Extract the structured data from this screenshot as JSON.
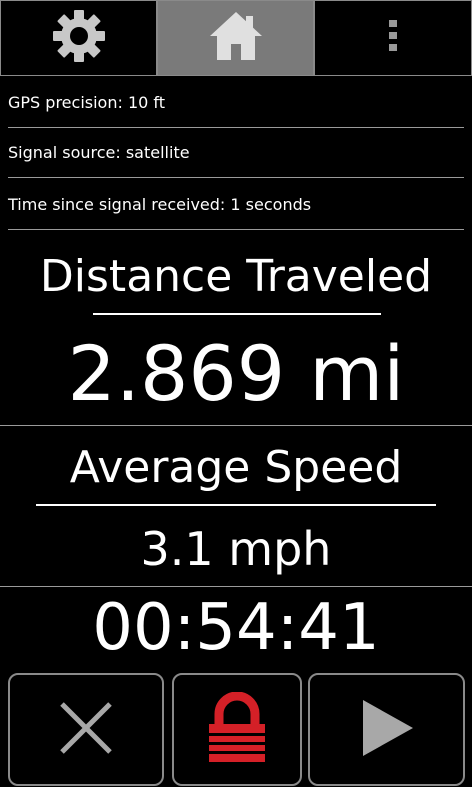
{
  "tabs": [
    {
      "name": "settings",
      "icon": "gear-icon",
      "active": false
    },
    {
      "name": "home",
      "icon": "home-icon",
      "active": true
    },
    {
      "name": "more",
      "icon": "more-vertical-icon",
      "active": false
    }
  ],
  "status": {
    "gps_precision": "GPS precision: 10 ft",
    "signal_source": "Signal source: satellite",
    "time_since_signal": "Time since signal received: 1 seconds"
  },
  "distance": {
    "label": "Distance Traveled",
    "value": "2.869 mi"
  },
  "speed": {
    "label": "Average Speed",
    "value": "3.1 mph"
  },
  "timer": {
    "value": "00:54:41"
  },
  "controls": {
    "cancel_icon": "close-icon",
    "lock_icon": "lock-icon",
    "play_icon": "play-icon"
  },
  "colors": {
    "lock_red": "#d42027",
    "active_tab": "#7a7a7a",
    "icon_gray": "#a8a8a8"
  }
}
